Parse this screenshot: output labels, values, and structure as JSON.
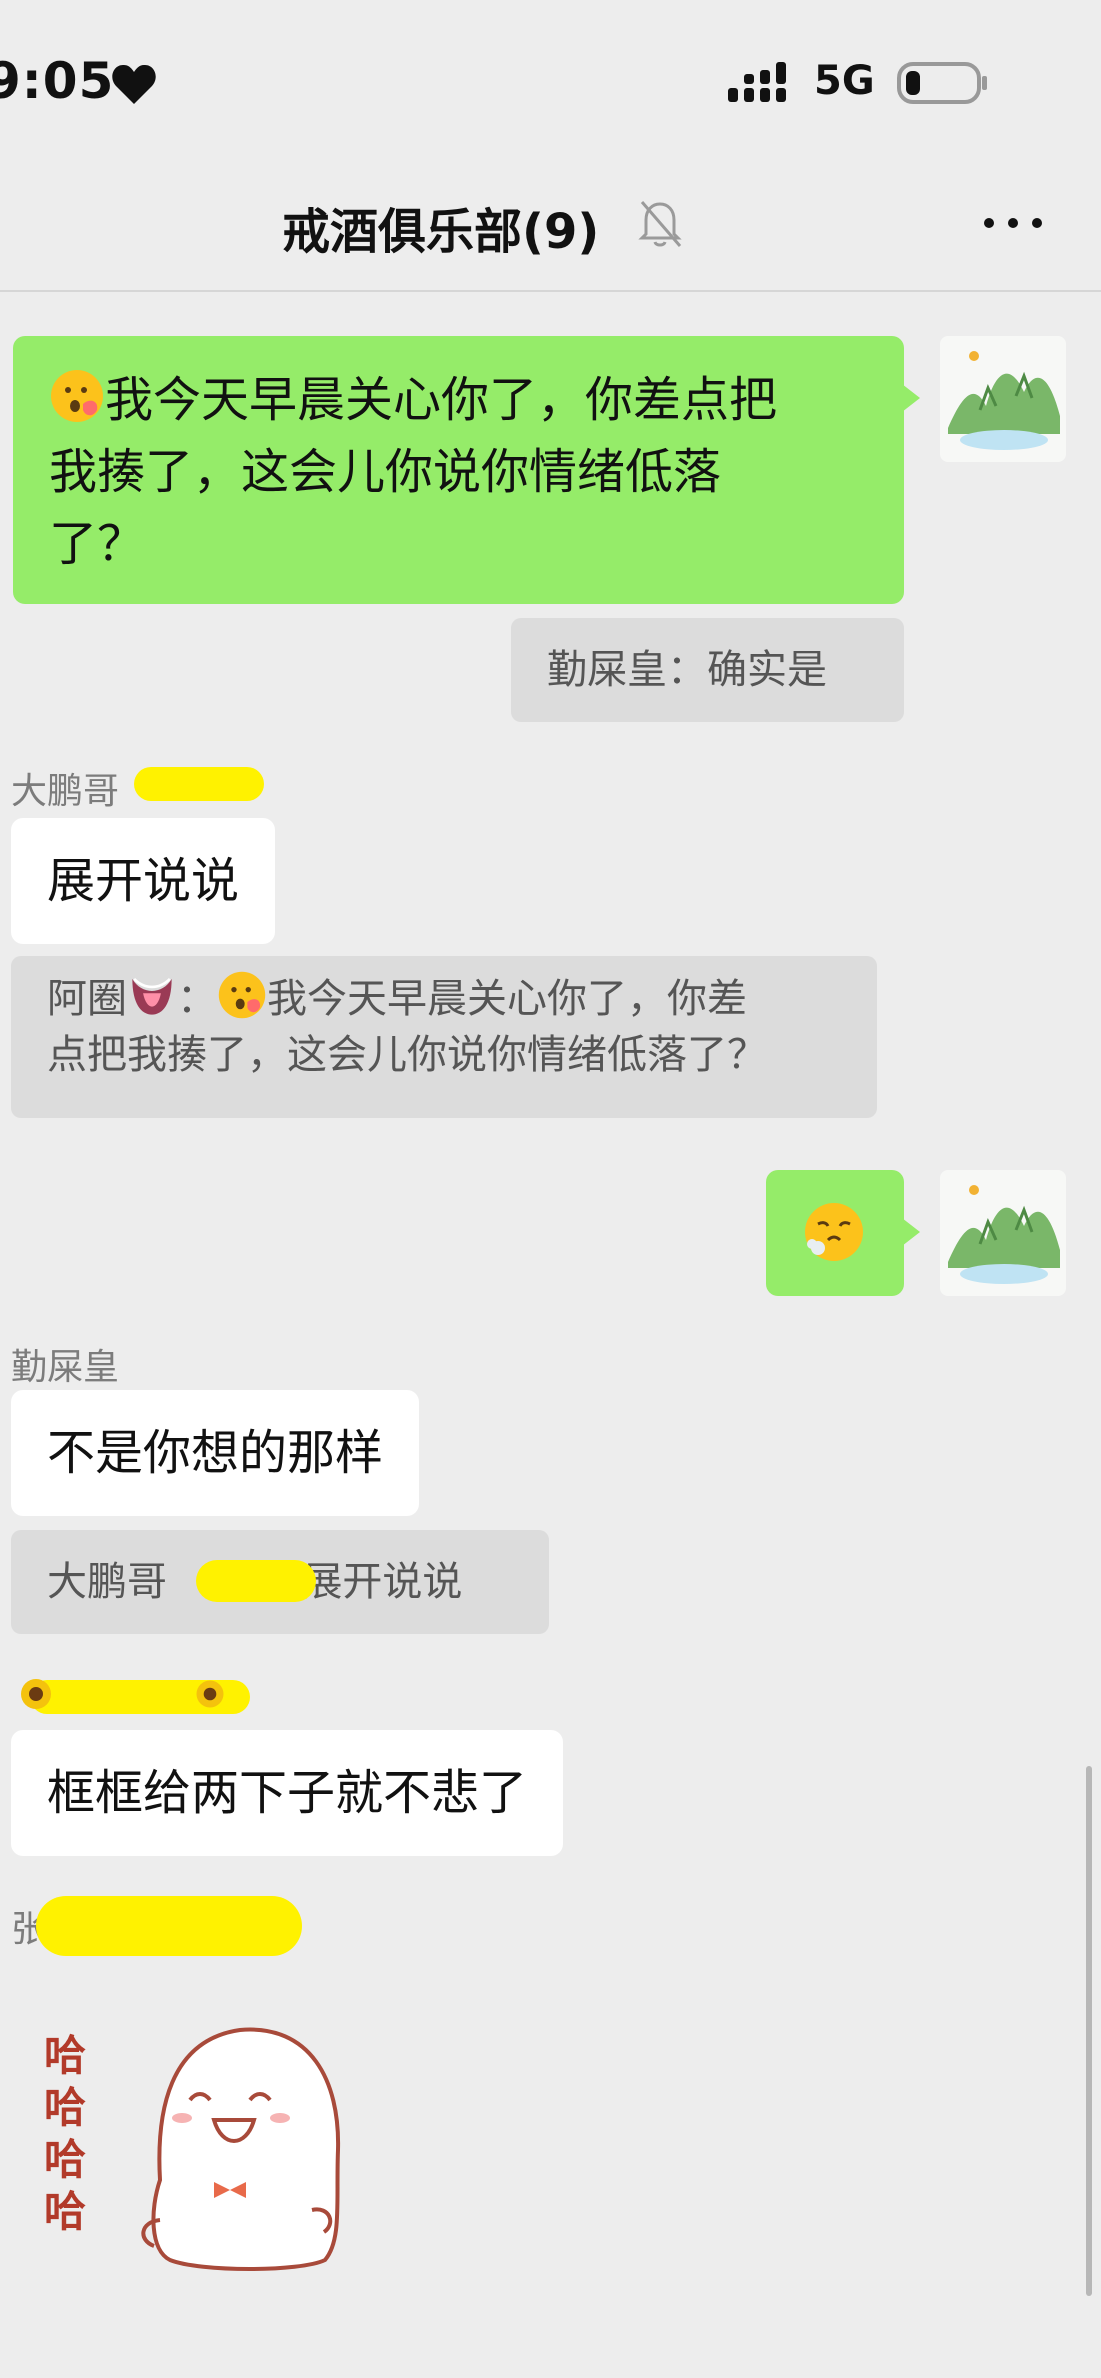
{
  "status_bar": {
    "time": "9:05",
    "network": "5G",
    "icons": [
      "heart-icon",
      "signal-icon",
      "battery-icon"
    ]
  },
  "nav": {
    "title": "戒酒俱乐部(9)",
    "icons": [
      "mute-icon",
      "more-icon"
    ]
  },
  "messages": {
    "m1": {
      "text": "我今天早晨关心你了，你差点把\n我揍了，这会儿你说你情绪低落\n了？"
    },
    "m1_reply_quote": {
      "text": "勤屎皇：确实是"
    },
    "m2": {
      "sender": "大鹏哥",
      "text": "展开说说"
    },
    "m2_quote": {
      "prefix": "阿圈",
      "sep": "：",
      "line1": "我今天早晨关心你了，你差",
      "line2": "点把我揍了，这会儿你说你情绪低落了？"
    },
    "m4": {
      "sender": "勤屎皇",
      "text": "不是你想的那样"
    },
    "m4_quote": {
      "left": "大鹏哥",
      "right": "展开说说"
    },
    "m5": {
      "text": "框框给两下子就不悲了"
    },
    "m6": {
      "sender_initial": "张",
      "sticker_text": [
        "哈",
        "哈",
        "哈",
        "哈"
      ]
    }
  },
  "colors": {
    "my_bubble": "#95ec69",
    "other_bubble": "#ffffff",
    "quote_bg": "#dcdcdc",
    "redaction": "#fff200",
    "background": "#ededed"
  }
}
